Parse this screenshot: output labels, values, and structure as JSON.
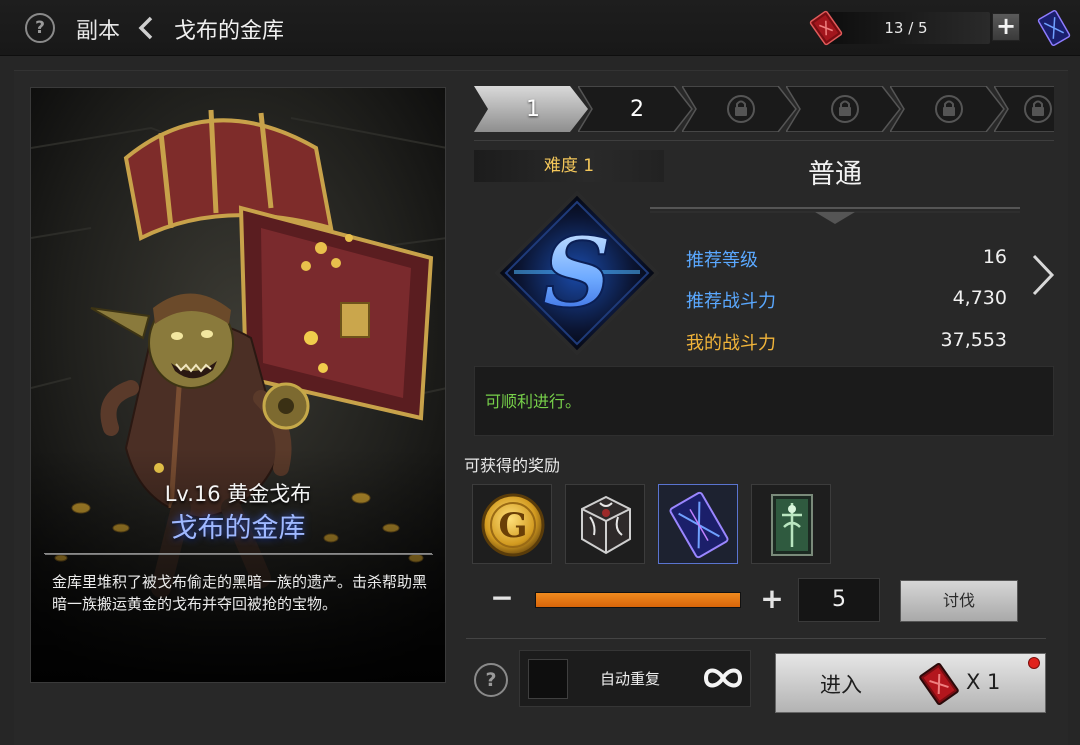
{
  "topbar": {
    "breadcrumb_root": "副本",
    "title": "戈布的金库",
    "ticket_count": "13 / 5",
    "add_label": "+",
    "help_label": "?"
  },
  "card": {
    "level_name": "Lv.16 黄金戈布",
    "dungeon_name": "戈布的金库",
    "description": "金库里堆积了被戈布偷走的黑暗一族的遗产。击杀帮助黑暗一族搬运黄金的戈布并夺回被抢的宝物。"
  },
  "stages": [
    {
      "label": "1",
      "state": "active"
    },
    {
      "label": "2",
      "state": "unlocked"
    },
    {
      "label": "",
      "state": "locked"
    },
    {
      "label": "",
      "state": "locked"
    },
    {
      "label": "",
      "state": "locked"
    },
    {
      "label": "",
      "state": "locked"
    }
  ],
  "difficulty": {
    "label": "难度 1",
    "name": "普通",
    "rank": "S"
  },
  "stats": {
    "recommended_level_label": "推荐等级",
    "recommended_level": "16",
    "recommended_power_label": "推荐战斗力",
    "recommended_power": "4,730",
    "my_power_label": "我的战斗力",
    "my_power": "37,553"
  },
  "status_message": "可顺利进行。",
  "rewards": {
    "title": "可获得的奖励",
    "items": [
      {
        "icon": "gold-coin-icon"
      },
      {
        "icon": "dark-cube-icon"
      },
      {
        "icon": "blue-card-icon",
        "selected": true
      },
      {
        "icon": "green-card-icon"
      }
    ]
  },
  "quantity": {
    "minus": "−",
    "plus": "+",
    "value": "5",
    "fill_fraction": 1.0,
    "sweep_label": "讨伐"
  },
  "bottom": {
    "help_label": "?",
    "auto_repeat_label": "自动重复",
    "enter_label": "进入",
    "enter_cost": "X 1"
  },
  "colors": {
    "accent_orange": "#e87a16",
    "difficulty_gold": "#f4c75a",
    "recommend_blue": "#5aa8ff",
    "my_power_gold": "#f2b53a",
    "status_green": "#77d04a",
    "name_blue": "#9fb8ff"
  }
}
